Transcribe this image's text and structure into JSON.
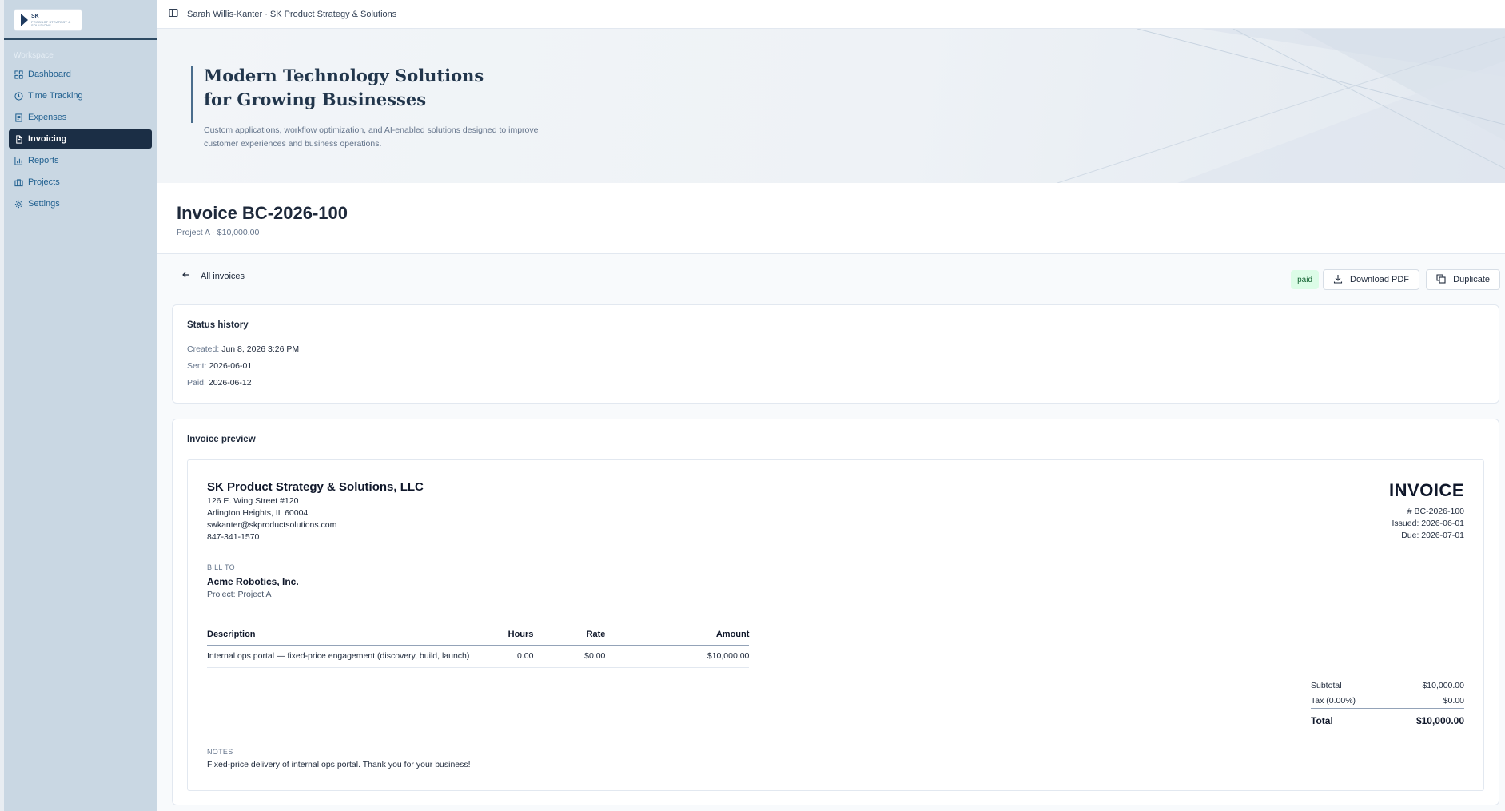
{
  "app": {
    "breadcrumb": "Sarah Willis-Kanter · SK Product Strategy & Solutions",
    "logo": {
      "mark": "SK",
      "sub": "PRODUCT STRATEGY & SOLUTIONS"
    }
  },
  "sidebar": {
    "section_label": "Workspace",
    "items": [
      {
        "label": "Dashboard",
        "icon": "dashboard-icon",
        "active": false
      },
      {
        "label": "Time Tracking",
        "icon": "clock-icon",
        "active": false
      },
      {
        "label": "Expenses",
        "icon": "receipt-icon",
        "active": false
      },
      {
        "label": "Invoicing",
        "icon": "file-text-icon",
        "active": true
      },
      {
        "label": "Reports",
        "icon": "bar-chart-icon",
        "active": false
      },
      {
        "label": "Projects",
        "icon": "briefcase-icon",
        "active": false
      },
      {
        "label": "Settings",
        "icon": "gear-icon",
        "active": false
      }
    ]
  },
  "hero": {
    "title_line1": "Modern Technology Solutions",
    "title_line2": "for Growing Businesses",
    "desc_line1": "Custom applications, workflow optimization, and AI-enabled solutions designed to improve",
    "desc_line2": "customer experiences and business operations."
  },
  "invoice_header": {
    "title": "Invoice BC-2026-100",
    "subtitle": "Project A · $10,000.00"
  },
  "actions": {
    "back_label": "All invoices",
    "status_badge": "paid",
    "download_label": "Download PDF",
    "duplicate_label": "Duplicate"
  },
  "status_history": {
    "title": "Status history",
    "created_label": "Created:",
    "created_value": "Jun 8, 2026 3:26 PM",
    "sent_label": "Sent:",
    "sent_value": "2026-06-01",
    "paid_label": "Paid:",
    "paid_value": "2026-06-12"
  },
  "preview": {
    "title": "Invoice preview",
    "company": {
      "name": "SK Product Strategy & Solutions, LLC",
      "address1": "126 E. Wing Street #120",
      "address2": "Arlington Heights, IL 60004",
      "email": "swkanter@skproductsolutions.com",
      "phone": "847-341-1570"
    },
    "doc_label": "INVOICE",
    "number": "# BC-2026-100",
    "issued": "Issued: 2026-06-01",
    "due": "Due: 2026-07-01",
    "bill_to_label": "BILL TO",
    "bill_to_name": "Acme Robotics, Inc.",
    "bill_to_project": "Project: Project A",
    "table": {
      "headers": {
        "description": "Description",
        "hours": "Hours",
        "rate": "Rate",
        "amount": "Amount"
      },
      "rows": [
        {
          "description": "Internal ops portal — fixed-price engagement (discovery, build, launch)",
          "hours": "0.00",
          "rate": "$0.00",
          "amount": "$10,000.00"
        }
      ]
    },
    "totals": {
      "subtotal_label": "Subtotal",
      "subtotal": "$10,000.00",
      "tax_label": "Tax (0.00%)",
      "tax": "$0.00",
      "total_label": "Total",
      "total": "$10,000.00"
    },
    "notes_label": "NOTES",
    "notes": "Fixed-price delivery of internal ops portal. Thank you for your business!"
  },
  "colors": {
    "sidebar_bg": "#c9d7e3",
    "active_nav": "#1b2e45",
    "nav_text": "#1f5f8f",
    "paid_badge_bg": "#dcfce7",
    "paid_badge_text": "#166534"
  }
}
